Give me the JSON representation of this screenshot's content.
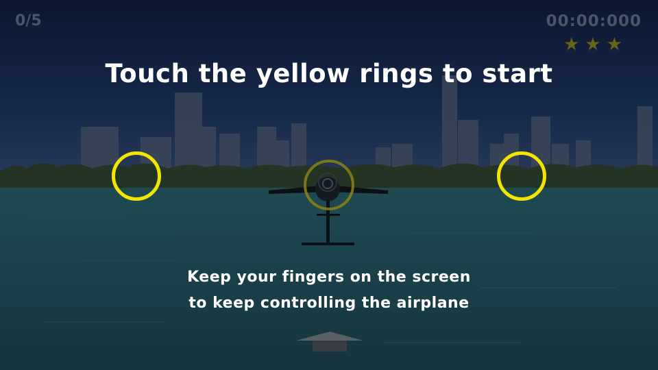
{
  "hud": {
    "rings_counter": "0/5",
    "timer": "00:00:000",
    "stars": [
      "★",
      "★",
      "★"
    ]
  },
  "messages": {
    "title": "Touch the yellow rings to start",
    "instruction_line1": "Keep your fingers on the screen",
    "instruction_line2": "to keep controlling the airplane"
  },
  "colors": {
    "ring": "#f2e600",
    "star": "#6b6414",
    "hud_text": "#4a5566"
  },
  "icons": {
    "ring_left": "yellow-ring-icon",
    "ring_right": "yellow-ring-icon",
    "airplane": "airplane-icon",
    "throttle": "up-arrow-icon"
  }
}
